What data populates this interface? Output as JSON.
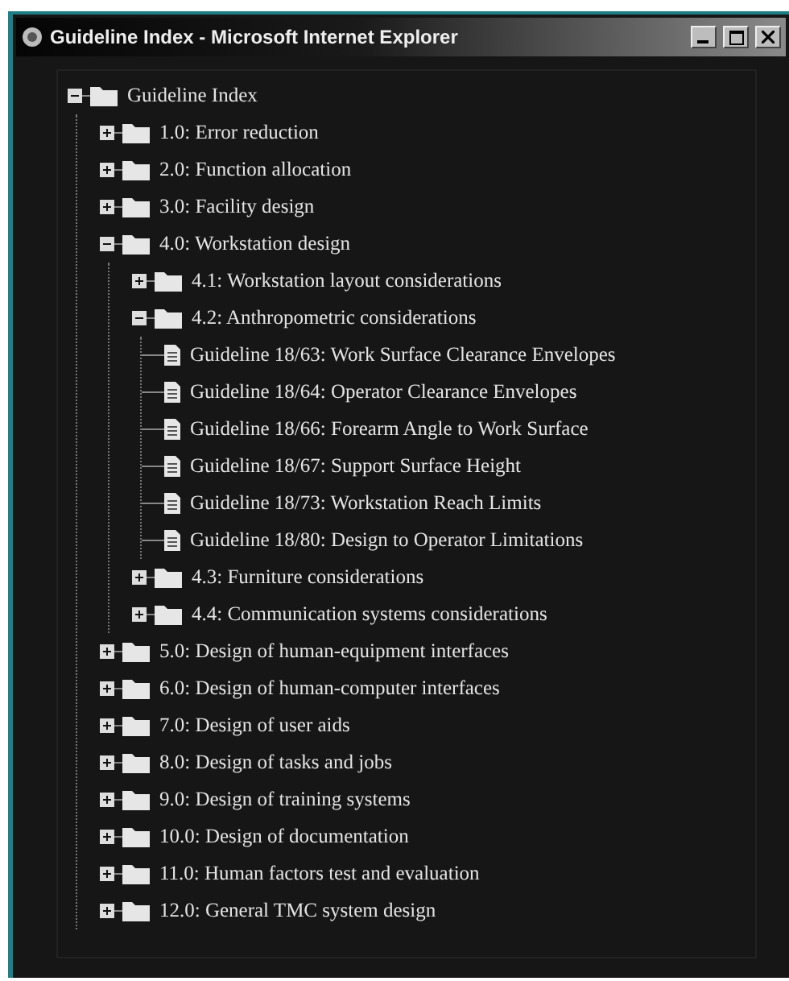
{
  "window": {
    "title": "Guideline Index - Microsoft Internet Explorer"
  },
  "tree": [
    {
      "kind": "folder",
      "label": "Guideline Index",
      "expanded": true,
      "children": [
        {
          "kind": "folder",
          "label": "1.0: Error reduction",
          "expanded": false
        },
        {
          "kind": "folder",
          "label": "2.0: Function allocation",
          "expanded": false
        },
        {
          "kind": "folder",
          "label": "3.0: Facility design",
          "expanded": false
        },
        {
          "kind": "folder",
          "label": "4.0: Workstation design",
          "expanded": true,
          "children": [
            {
              "kind": "folder",
              "label": "4.1: Workstation layout considerations",
              "expanded": false
            },
            {
              "kind": "folder",
              "label": "4.2: Anthropometric considerations",
              "expanded": true,
              "children": [
                {
                  "kind": "document",
                  "label": "Guideline 18/63: Work Surface Clearance Envelopes"
                },
                {
                  "kind": "document",
                  "label": "Guideline 18/64: Operator Clearance Envelopes"
                },
                {
                  "kind": "document",
                  "label": "Guideline 18/66: Forearm Angle to Work Surface"
                },
                {
                  "kind": "document",
                  "label": "Guideline 18/67: Support Surface Height"
                },
                {
                  "kind": "document",
                  "label": "Guideline 18/73: Workstation Reach Limits"
                },
                {
                  "kind": "document",
                  "label": "Guideline 18/80: Design to Operator Limitations"
                }
              ]
            },
            {
              "kind": "folder",
              "label": "4.3: Furniture considerations",
              "expanded": false
            },
            {
              "kind": "folder",
              "label": "4.4: Communication systems considerations",
              "expanded": false
            }
          ]
        },
        {
          "kind": "folder",
          "label": "5.0: Design of human-equipment interfaces",
          "expanded": false
        },
        {
          "kind": "folder",
          "label": "6.0: Design of human-computer interfaces",
          "expanded": false
        },
        {
          "kind": "folder",
          "label": "7.0: Design of user aids",
          "expanded": false
        },
        {
          "kind": "folder",
          "label": "8.0: Design of tasks and jobs",
          "expanded": false
        },
        {
          "kind": "folder",
          "label": "9.0: Design of training systems",
          "expanded": false
        },
        {
          "kind": "folder",
          "label": "10.0: Design of documentation",
          "expanded": false
        },
        {
          "kind": "folder",
          "label": "11.0: Human factors test and evaluation",
          "expanded": false
        },
        {
          "kind": "folder",
          "label": "12.0: General TMC system design",
          "expanded": false
        }
      ]
    }
  ]
}
